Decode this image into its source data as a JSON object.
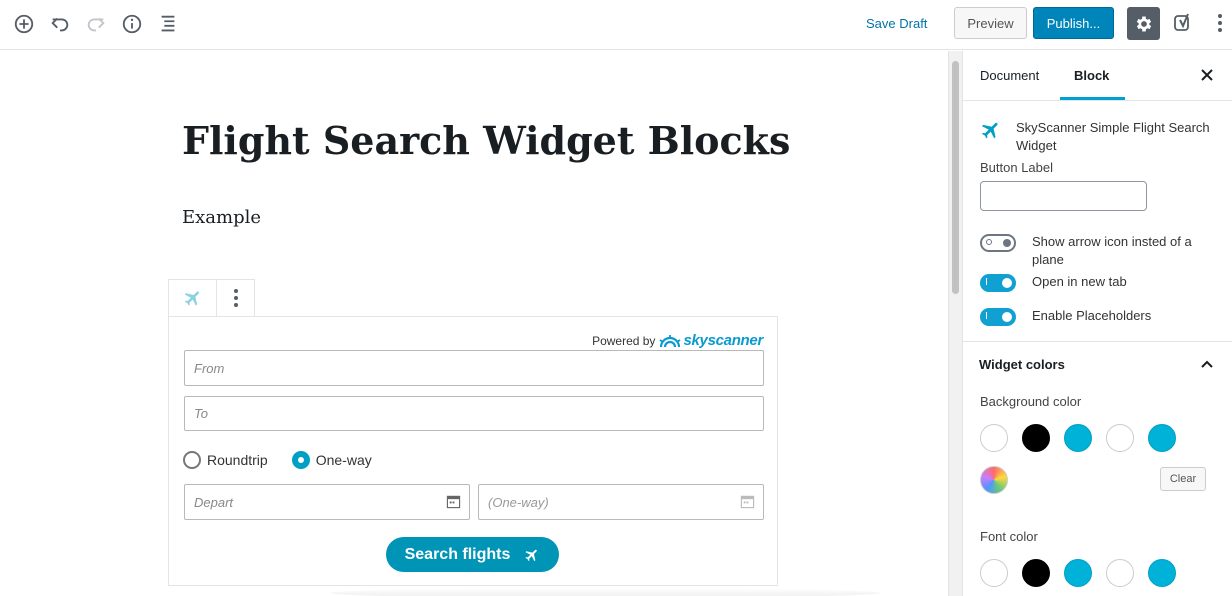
{
  "toolbar": {
    "save_draft": "Save Draft",
    "preview": "Preview",
    "publish": "Publish..."
  },
  "editor": {
    "title": "Flight Search Widget Blocks",
    "paragraph": "Example"
  },
  "widget": {
    "powered_by": "Powered by",
    "brand": "skyscanner",
    "from_placeholder": "From",
    "to_placeholder": "To",
    "trip_types": [
      {
        "label": "Roundtrip",
        "checked": false
      },
      {
        "label": "One-way",
        "checked": true
      }
    ],
    "depart_placeholder": "Depart",
    "return_placeholder": "(One-way)",
    "search_button": "Search flights"
  },
  "sidebar": {
    "tabs": [
      "Document",
      "Block"
    ],
    "active_tab": "Block",
    "block_name": "SkyScanner Simple Flight Search Widget",
    "button_label_field": "Button Label",
    "button_label_value": "",
    "toggles": [
      {
        "label": "Show arrow icon insted of a plane",
        "on": false
      },
      {
        "label": "Open in new tab",
        "on": true
      },
      {
        "label": "Enable Placeholders",
        "on": true
      }
    ],
    "panel_title": "Widget colors",
    "background_color_label": "Background color",
    "font_color_label": "Font color",
    "clear_button": "Clear",
    "palette": [
      "#ffffff",
      "#000000",
      "#00b1d8",
      "#ffffff",
      "#00b1d8"
    ]
  },
  "colors": {
    "accent": "#0085ba",
    "sky_blue": "#00a0c6",
    "search_button": "#0095b6",
    "toggle_on": "#11a0d2"
  }
}
